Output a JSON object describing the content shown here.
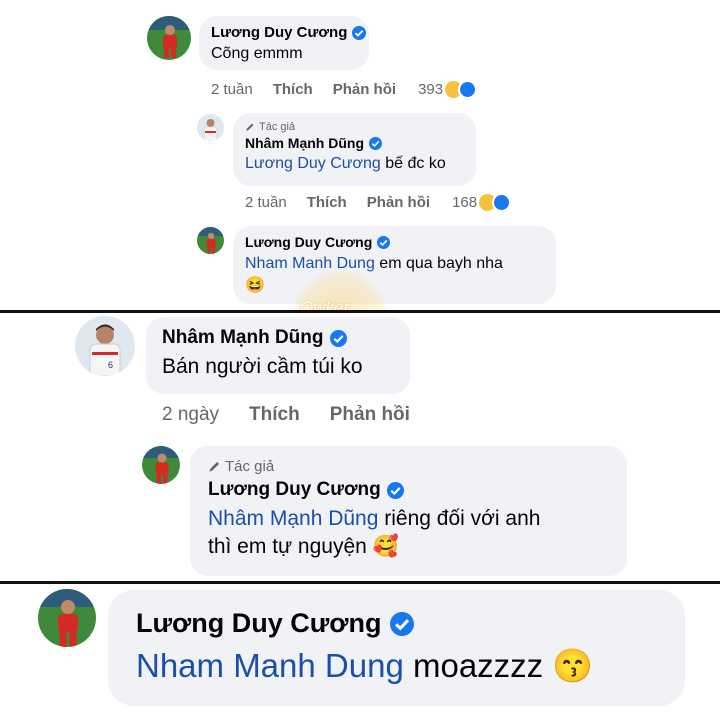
{
  "comments": [
    {
      "name": "Lương Duy Cương",
      "text": "Cõng emmm",
      "time": "2 tuần",
      "like_label": "Thích",
      "reply_label": "Phản hồi",
      "reaction_count": "393",
      "reactions": [
        "haha-icon",
        "like-icon"
      ],
      "replies": [
        {
          "author_tag": "Tác giả",
          "name": "Nhâm Mạnh Dũng",
          "mention": "Lương Duy Cương",
          "text": " bế đc ko",
          "time": "2 tuần",
          "like_label": "Thích",
          "reply_label": "Phản hồi",
          "reaction_count": "168",
          "reactions": [
            "haha-icon",
            "like-icon"
          ]
        },
        {
          "name": "Lương Duy Cương",
          "mention": "Nham Manh Dung",
          "text": " em qua bayh nha",
          "emoji": "😆"
        }
      ]
    },
    {
      "name": "Nhâm Mạnh Dũng",
      "text": "Bán người cầm túi ko",
      "time": "2 ngày",
      "like_label": "Thích",
      "reply_label": "Phản hồi",
      "replies": [
        {
          "author_tag": "Tác giả",
          "name": "Lương Duy Cương",
          "mention": "Nhâm Mạnh Dũng",
          "text_line1": " riêng đối với anh",
          "text_line2": "thì em tự nguyện",
          "emoji": "🥰"
        }
      ]
    },
    {
      "name": "Lương Duy Cương",
      "mention": "Nham Manh Dung",
      "text": " moazzzz",
      "emoji": "😙"
    }
  ],
  "watermark": "Owker",
  "colors": {
    "bubble": "#f0f2f5",
    "verified": "#1877f2",
    "mention": "#1b4fa8",
    "meta": "#65676b",
    "divider": "#111111"
  }
}
